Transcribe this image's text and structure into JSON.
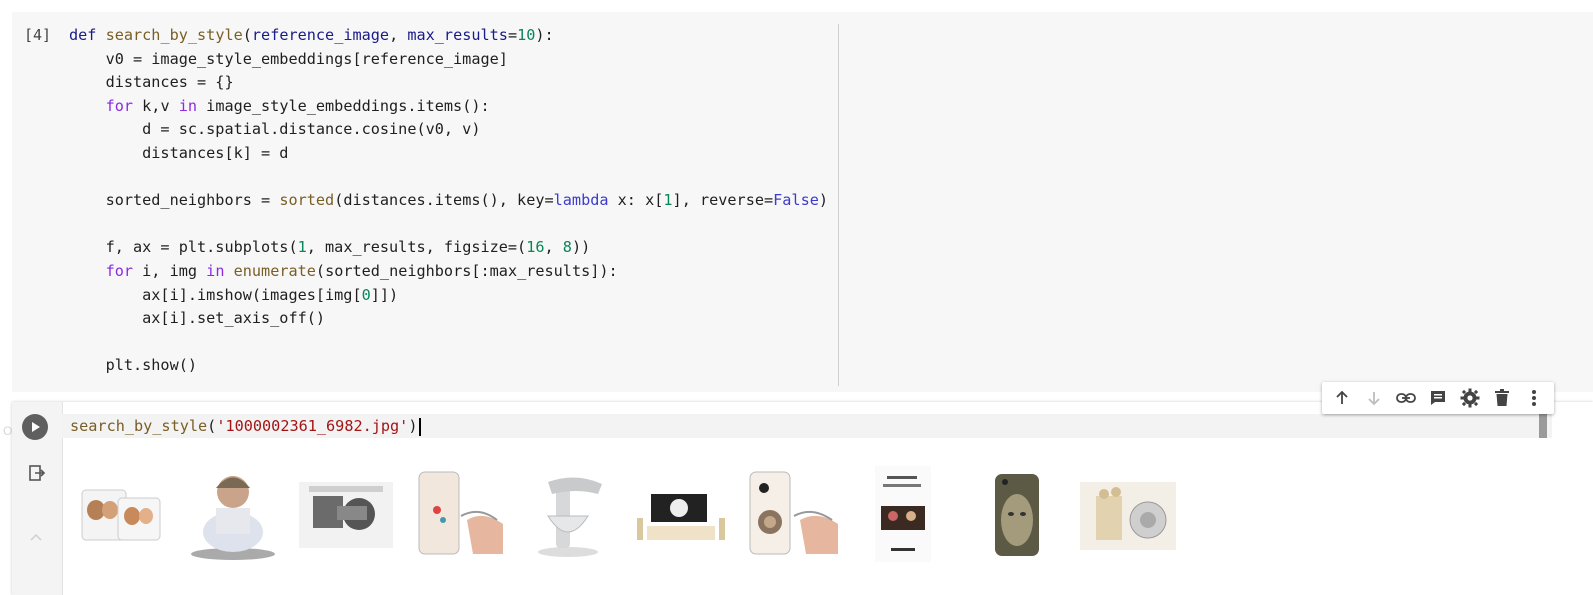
{
  "cell1": {
    "execution_count": "[4]",
    "code_lines": [
      "def search_by_style(reference_image, max_results=10):",
      "    v0 = image_style_embeddings[reference_image]",
      "    distances = {}",
      "    for k,v in image_style_embeddings.items():",
      "        d = sc.spatial.distance.cosine(v0, v)",
      "        distances[k] = d",
      "",
      "    sorted_neighbors = sorted(distances.items(), key=lambda x: x[1], reverse=False)",
      "",
      "    f, ax = plt.subplots(1, max_results, figsize=(16, 8))",
      "    for i, img in enumerate(sorted_neighbors[:max_results]):",
      "        ax[i].imshow(images[img[0]])",
      "        ax[i].set_axis_off()",
      "",
      "    plt.show()"
    ]
  },
  "cell2": {
    "code": "search_by_style('1000002361_6982.jpg')",
    "run_button_icon": "play-icon",
    "output_icon": "output-redirect-icon",
    "collapse_icon": "chevron-up-icon"
  },
  "toolbar": {
    "icons": [
      "arrow-up-icon",
      "arrow-down-icon",
      "link-icon",
      "comment-icon",
      "gear-icon",
      "trash-icon",
      "more-vert-icon"
    ]
  },
  "output_images": [
    "mugs-photo",
    "doll-photo",
    "engine-part-photo",
    "phone-case-photo",
    "stand-mixer-photo",
    "room-interior-photo",
    "phone-case-lion-photo",
    "book-cover-photo",
    "phone-case-face-photo",
    "figurine-photo"
  ],
  "colors": {
    "keyword": "#8a2be2",
    "builtin": "#3b3bce",
    "function": "#795e26",
    "number": "#098658",
    "string": "#a31515"
  }
}
